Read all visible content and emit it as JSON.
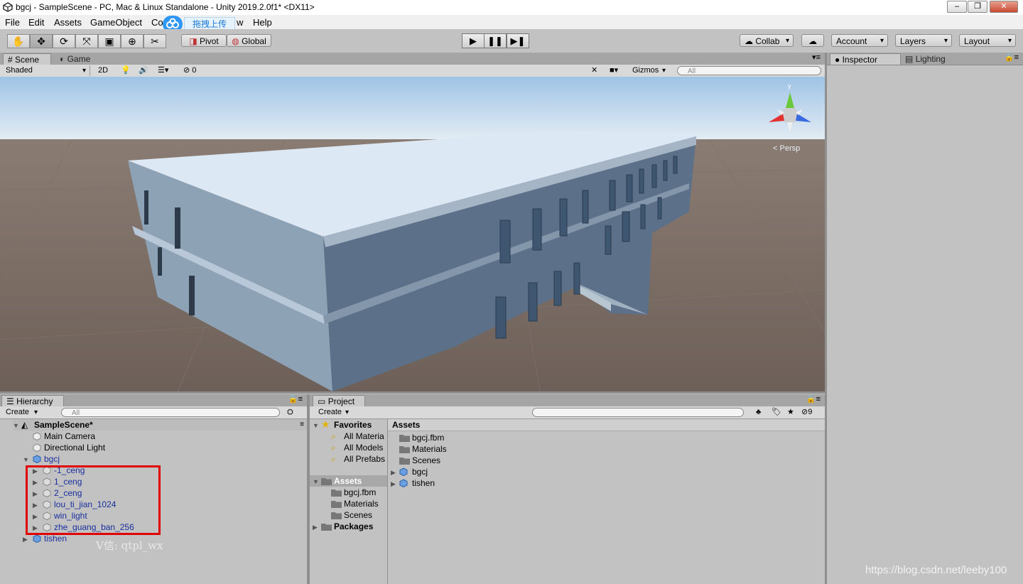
{
  "window": {
    "title": "bgcj - SampleScene - PC, Mac & Linux Standalone - Unity 2019.2.0f1* <DX11>"
  },
  "menu": [
    "File",
    "Edit",
    "Assets",
    "GameObject",
    "Co",
    "w",
    "Help"
  ],
  "overlay_badge": {
    "label": "拖拽上传",
    "icon": "baidu-cloud-icon"
  },
  "toolbar": {
    "tools": [
      "hand-tool-icon",
      "move-tool-icon",
      "rotate-tool-icon",
      "scale-tool-icon",
      "rect-tool-icon",
      "transform-tool-icon",
      "custom-tool-icon"
    ],
    "pivot_label": "Pivot",
    "global_label": "Global",
    "collab_label": "Collab",
    "account_label": "Account",
    "layers_label": "Layers",
    "layout_label": "Layout"
  },
  "scene_tabs": {
    "scene": "Scene",
    "game": "Game"
  },
  "scene_bar": {
    "shading": "Shaded",
    "mode_2d": "2D",
    "fx_count": "0",
    "gizmos": "Gizmos",
    "search_placeholder": "All"
  },
  "scene_view": {
    "projection_label": "Persp",
    "gizmo_y": "y"
  },
  "right_tabs": {
    "inspector": "Inspector",
    "lighting": "Lighting"
  },
  "hierarchy": {
    "tab": "Hierarchy",
    "create": "Create",
    "search_placeholder": "All",
    "scene_name": "SampleScene*",
    "items": [
      {
        "label": "Main Camera"
      },
      {
        "label": "Directional Light"
      },
      {
        "label": "bgcj"
      },
      {
        "label": "-1_ceng"
      },
      {
        "label": "1_ceng"
      },
      {
        "label": "2_ceng"
      },
      {
        "label": "lou_ti_jian_1024"
      },
      {
        "label": "win_light"
      },
      {
        "label": "zhe_guang_ban_256"
      },
      {
        "label": "tishen"
      }
    ]
  },
  "project": {
    "tab": "Project",
    "create": "Create",
    "hidden_count": "9",
    "favorites": {
      "label": "Favorites",
      "items": [
        "All Materia",
        "All Models",
        "All Prefabs"
      ]
    },
    "assets_tree": {
      "label": "Assets",
      "items": [
        "bgcj.fbm",
        "Materials",
        "Scenes"
      ]
    },
    "packages": "Packages",
    "assets_header": "Assets",
    "assets_list": [
      "bgcj.fbm",
      "Materials",
      "Scenes",
      "bgcj",
      "tishen"
    ]
  },
  "watermarks": {
    "wechat": "V信: qtpl_wx",
    "blog": "https://blog.csdn.net/leeby100"
  }
}
